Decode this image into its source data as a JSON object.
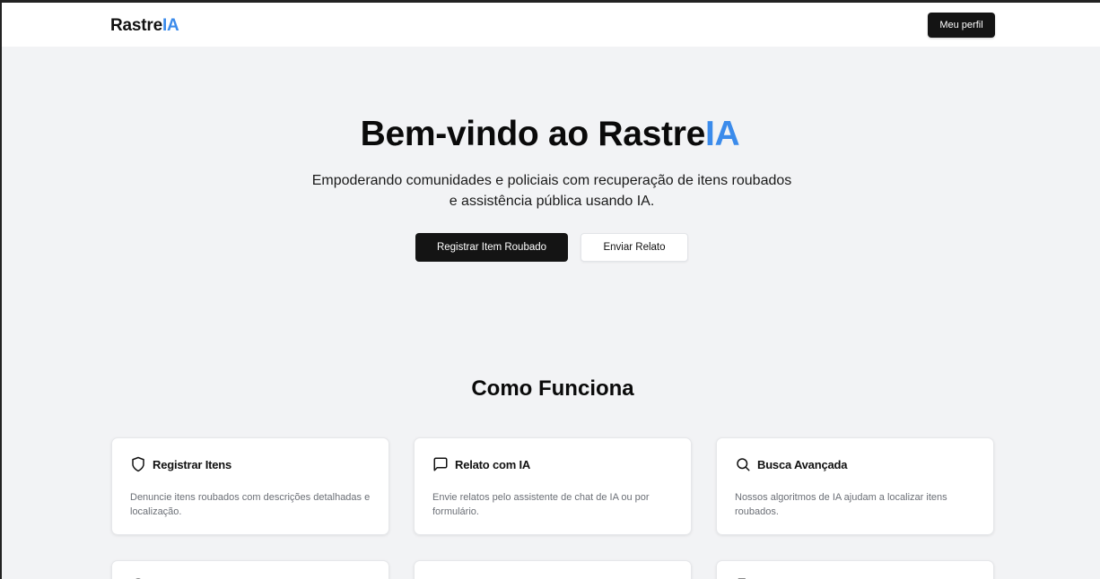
{
  "navbar": {
    "logo_main": "Rastre",
    "logo_accent": "IA",
    "profile_label": "Meu perfil"
  },
  "hero": {
    "title_main": "Bem-vindo ao Rastre",
    "title_accent": "IA",
    "subtitle_line1": "Empoderando comunidades e policiais com recuperação de itens roubados",
    "subtitle_line2": "e assistência pública usando IA.",
    "primary_button": "Registrar Item Roubado",
    "secondary_button": "Enviar Relato"
  },
  "how_it_works": {
    "title": "Como Funciona",
    "cards": [
      {
        "icon": "shield-icon",
        "title": "Registrar Itens",
        "description": "Denuncie itens roubados com descrições detalhadas e localização."
      },
      {
        "icon": "message-square-icon",
        "title": "Relato com IA",
        "description": "Envie relatos pelo assistente de chat de IA ou por formulário."
      },
      {
        "icon": "search-icon",
        "title": "Busca Avançada",
        "description": "Nossos algoritmos de IA ajudam a localizar itens roubados."
      }
    ]
  },
  "colors": {
    "accent": "#3b8beb",
    "primary": "#141414",
    "background": "#f2f3f5"
  }
}
